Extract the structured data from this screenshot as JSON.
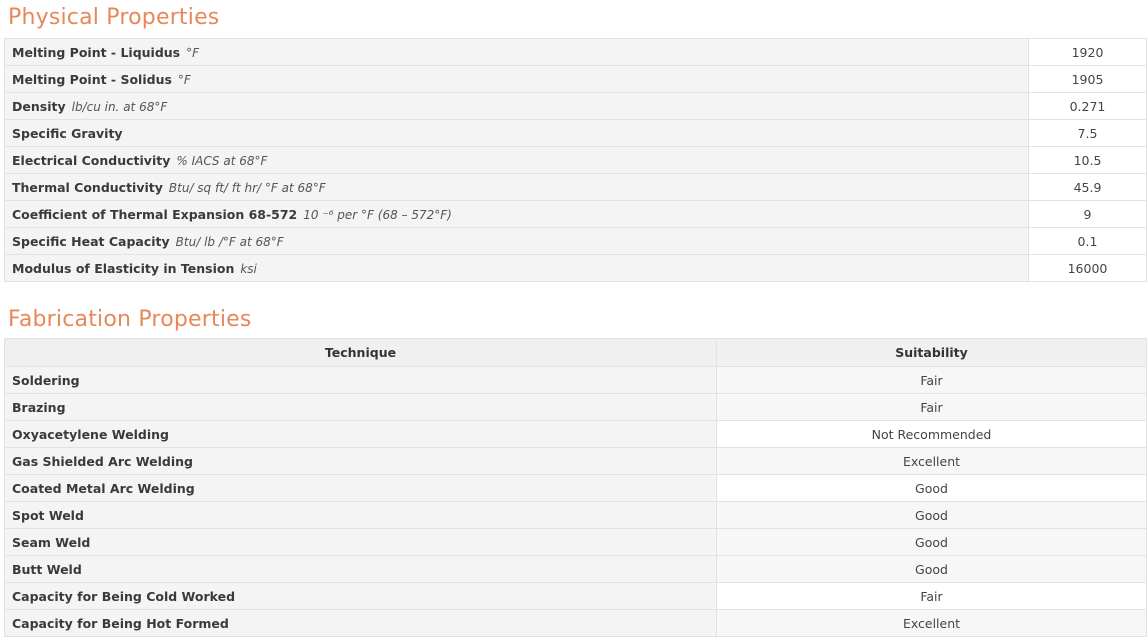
{
  "physical": {
    "title": "Physical Properties",
    "rows": [
      {
        "name": "Melting Point - Liquidus",
        "unit": "°F",
        "value": "1920"
      },
      {
        "name": "Melting Point - Solidus",
        "unit": "°F",
        "value": "1905"
      },
      {
        "name": "Density",
        "unit": "lb/cu in. at 68°F",
        "value": "0.271"
      },
      {
        "name": "Specific Gravity",
        "unit": "",
        "value": "7.5"
      },
      {
        "name": "Electrical Conductivity",
        "unit": "% IACS at 68°F",
        "value": "10.5"
      },
      {
        "name": "Thermal Conductivity",
        "unit": "Btu/ sq ft/ ft hr/ °F at 68°F",
        "value": "45.9"
      },
      {
        "name": "Coefficient of Thermal Expansion 68-572",
        "unit": "10 ⁻⁶ per °F (68 – 572°F)",
        "value": "9"
      },
      {
        "name": "Specific Heat Capacity",
        "unit": "Btu/ lb /°F at 68°F",
        "value": "0.1"
      },
      {
        "name": "Modulus of Elasticity in Tension",
        "unit": "ksi",
        "value": "16000"
      }
    ]
  },
  "fabrication": {
    "title": "Fabrication Properties",
    "headers": {
      "technique": "Technique",
      "suitability": "Suitability"
    },
    "rows": [
      {
        "technique": "Soldering",
        "suitability": "Fair"
      },
      {
        "technique": "Brazing",
        "suitability": "Fair"
      },
      {
        "technique": "Oxyacetylene Welding",
        "suitability": "Not Recommended"
      },
      {
        "technique": "Gas Shielded Arc Welding",
        "suitability": "Excellent"
      },
      {
        "technique": "Coated Metal Arc Welding",
        "suitability": "Good"
      },
      {
        "technique": "Spot Weld",
        "suitability": "Good"
      },
      {
        "technique": "Seam Weld",
        "suitability": "Good"
      },
      {
        "technique": "Butt Weld",
        "suitability": "Good"
      },
      {
        "technique": "Capacity for Being Cold Worked",
        "suitability": "Fair"
      },
      {
        "technique": "Capacity for Being Hot Formed",
        "suitability": "Excellent"
      }
    ]
  },
  "colors": {
    "heading": "#e8875a",
    "border": "#dfe3e3",
    "label_bg": "#f4f4f4"
  }
}
